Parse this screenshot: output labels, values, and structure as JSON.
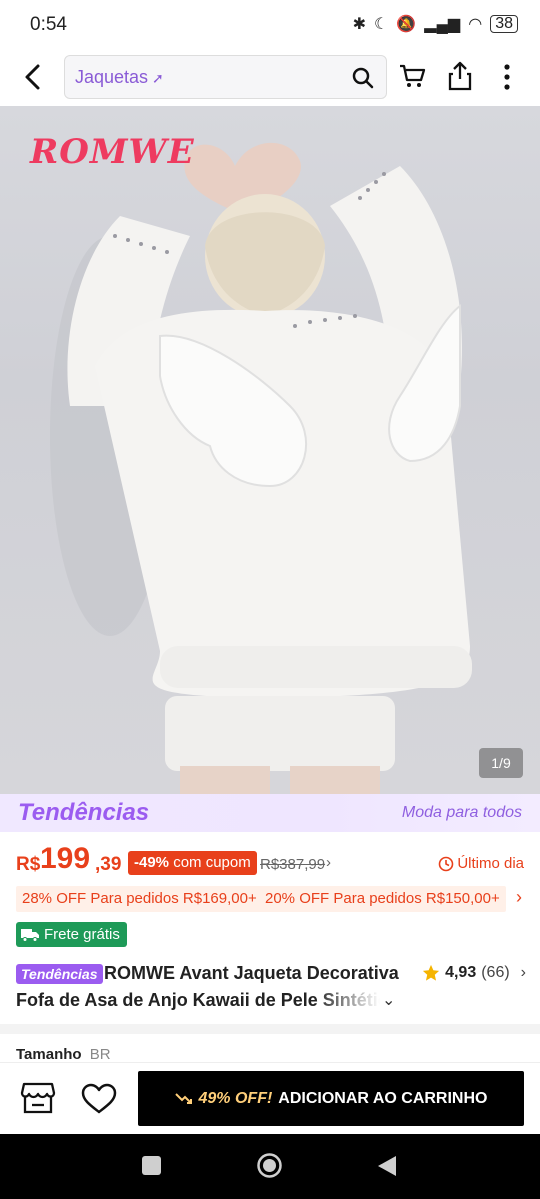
{
  "status_bar": {
    "time": "0:54",
    "battery": "38"
  },
  "search": {
    "query": "Jaquetas"
  },
  "hero": {
    "brand_logo": "ROMWE",
    "image_counter": "1/9"
  },
  "trends_band": {
    "logo": "Tendências",
    "tagline": "Moda para todos"
  },
  "price": {
    "currency": "R$",
    "integer": "199",
    "decimal": ",39",
    "discount_percent": "-49%",
    "coupon_text": "com cupom",
    "original_price": "R$387,99",
    "urgency": "Último dia"
  },
  "discount_tags": [
    "28% OFF Para pedidos R$169,00+",
    "20% OFF Para pedidos R$150,00+"
  ],
  "shipping": {
    "label": "Frete grátis"
  },
  "product": {
    "tag": "Tendências",
    "title_line1": "ROMWE Avant Jaqueta Decorativa",
    "title_line2": "Fofa de Asa de Anjo Kawaii de Pele Sintética",
    "rating": "4,93",
    "review_count": "(66)"
  },
  "size_selector": {
    "label": "Tamanho",
    "region": "BR"
  },
  "action_bar": {
    "promo": "49% OFF!",
    "add_to_cart": "ADICIONAR AO CARRINHO"
  },
  "colors": {
    "accent_orange": "#e8401b",
    "trends_purple": "#9b5cf0",
    "free_shipping_green": "#1e9a58",
    "brand_pink": "#ee3b60"
  }
}
